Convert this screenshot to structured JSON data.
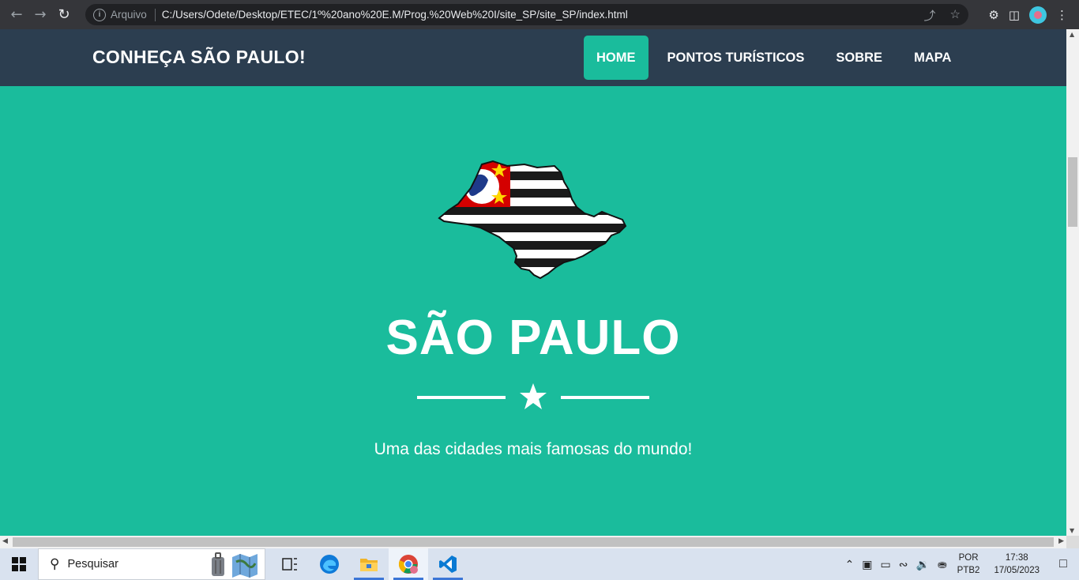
{
  "browser": {
    "back_icon": "arrow-left-icon",
    "forward_icon": "arrow-right-icon",
    "reload_icon": "reload-icon",
    "scheme_label": "Arquivo",
    "url": "C:/Users/Odete/Desktop/ETEC/1º%20ano%20E.M/Prog.%20Web%20I/site_SP/site_SP/index.html"
  },
  "site": {
    "brand": "CONHEÇA SÃO PAULO!",
    "menu": [
      {
        "label": "HOME",
        "active": true
      },
      {
        "label": "PONTOS TURÍSTICOS",
        "active": false
      },
      {
        "label": "SOBRE",
        "active": false
      },
      {
        "label": "MAPA",
        "active": false
      }
    ],
    "accent_color": "#1abc9c",
    "nav_color": "#2c3e50"
  },
  "hero": {
    "title": "SÃO PAULO",
    "subtitle": "Uma das cidades mais famosas do mundo!",
    "divider_icon": "star-icon",
    "image": "sao-paulo-state-flag-map"
  },
  "taskbar": {
    "search_placeholder": "Pesquisar",
    "lang_line1": "POR",
    "lang_line2": "PTB2",
    "time": "17:38",
    "date": "17/05/2023"
  }
}
